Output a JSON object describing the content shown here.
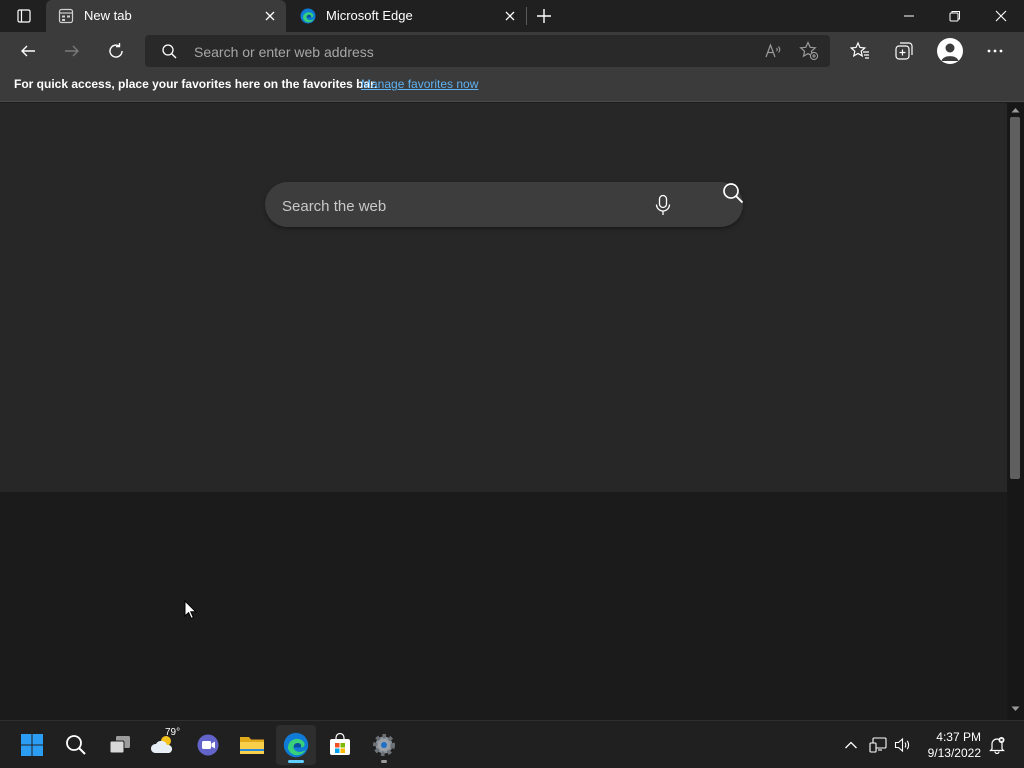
{
  "tabs": [
    {
      "title": "New tab",
      "active": true
    },
    {
      "title": "Microsoft Edge",
      "active": false
    }
  ],
  "address_bar": {
    "placeholder": "Search or enter web address",
    "value": ""
  },
  "favorites_bar": {
    "message": "For quick access, place your favorites here on the favorites bar.",
    "link": "Manage favorites now"
  },
  "web_search": {
    "placeholder": "Search the web",
    "value": ""
  },
  "taskbar": {
    "weather_temp": "79°",
    "apps": [
      "windows-start",
      "search",
      "task-view",
      "weather",
      "teams-chat",
      "file-explorer",
      "microsoft-edge",
      "microsoft-store",
      "settings"
    ]
  },
  "clock": {
    "time": "4:37 PM",
    "date": "9/13/2022"
  },
  "colors": {
    "accent": "#60cdff",
    "link": "#5fb2f2",
    "toolbar": "#3b3b3b",
    "titlebar": "#202020"
  }
}
